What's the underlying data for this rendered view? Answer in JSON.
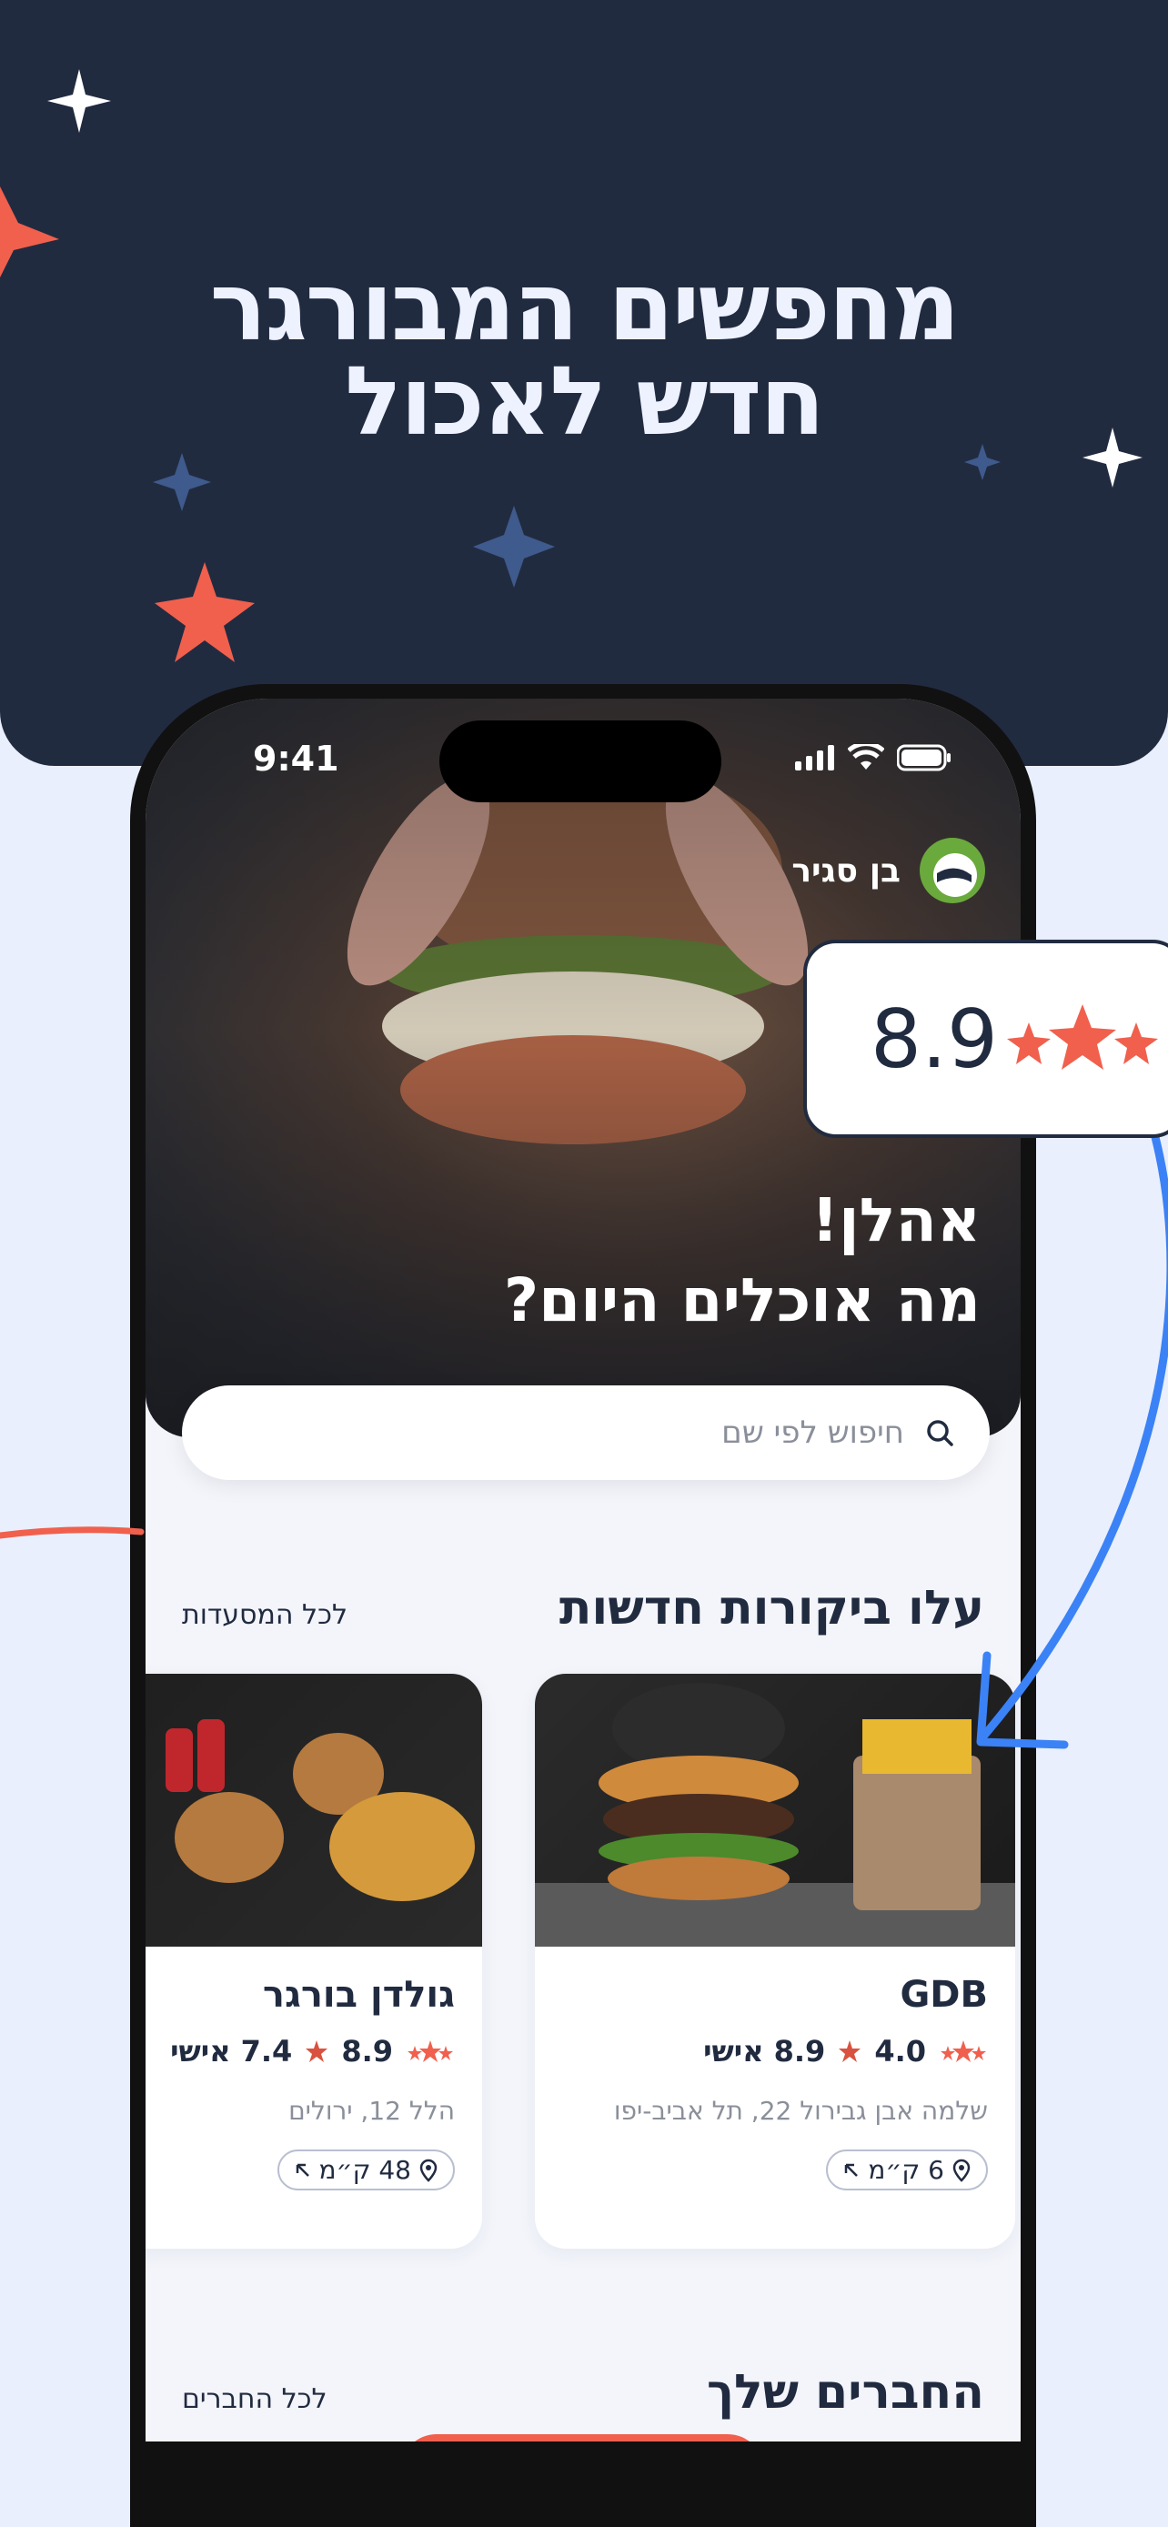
{
  "hero": {
    "headline_line1": "מחפשים המבורגר",
    "headline_line2": "חדש לאכול"
  },
  "status_bar": {
    "time": "9:41"
  },
  "user": {
    "name": "בן סגיר"
  },
  "greeting": {
    "line1": "אהלן!",
    "line2": "מה אוכלים היום?"
  },
  "search": {
    "placeholder": "חיפוש לפי שם"
  },
  "reviews_section": {
    "title": "עלו ביקורות חדשות",
    "see_all": "לכל המסעדות"
  },
  "restaurants": [
    {
      "name": "GDB",
      "rating": "4.0",
      "personal": "8.9 אישי",
      "address": "שלמה אבן גבירול 22, תל אביב-יפו",
      "distance": "6 ק״מ"
    },
    {
      "name": "גולדן בורגר",
      "rating": "8.9",
      "personal": "7.4 אישי",
      "address": "הלל 12, ירולים",
      "distance": "48 ק״מ"
    }
  ],
  "friends_section": {
    "title": "החברים שלך",
    "see_all": "לכל החברים"
  },
  "rating_callout": {
    "value": "8.9"
  },
  "colors": {
    "navy": "#212b40",
    "accent": "#f0604d",
    "blue": "#3b82f6",
    "background": "#e9effc"
  }
}
